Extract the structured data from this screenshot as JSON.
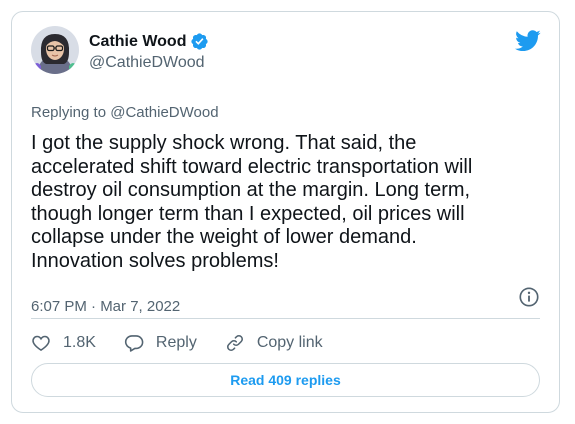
{
  "author": {
    "name": "Cathie Wood",
    "handle": "@CathieDWood"
  },
  "replying_to": {
    "prefix": "Replying to",
    "mention": "@CathieDWood"
  },
  "tweet": {
    "text": "I got the supply shock wrong. That said, the\naccelerated shift toward electric transportation will\ndestroy oil consumption at the margin. Long term,\nthough longer term than I expected, oil prices will\ncollapse under the weight of lower demand.\nInnovation solves problems!",
    "timestamp": "6:07 PM · Mar 7, 2022"
  },
  "actions": {
    "like_count": "1.8K",
    "reply_label": "Reply",
    "copy_link_label": "Copy link"
  },
  "read_replies_label": "Read 409 replies",
  "colors": {
    "brand_blue": "#1d9bf0",
    "secondary_text": "#536471",
    "border": "#cfd9de"
  },
  "icons": [
    "avatar",
    "verified-badge-icon",
    "twitter-bird-icon",
    "info-icon",
    "heart-icon",
    "reply-bubble-icon",
    "link-icon"
  ]
}
